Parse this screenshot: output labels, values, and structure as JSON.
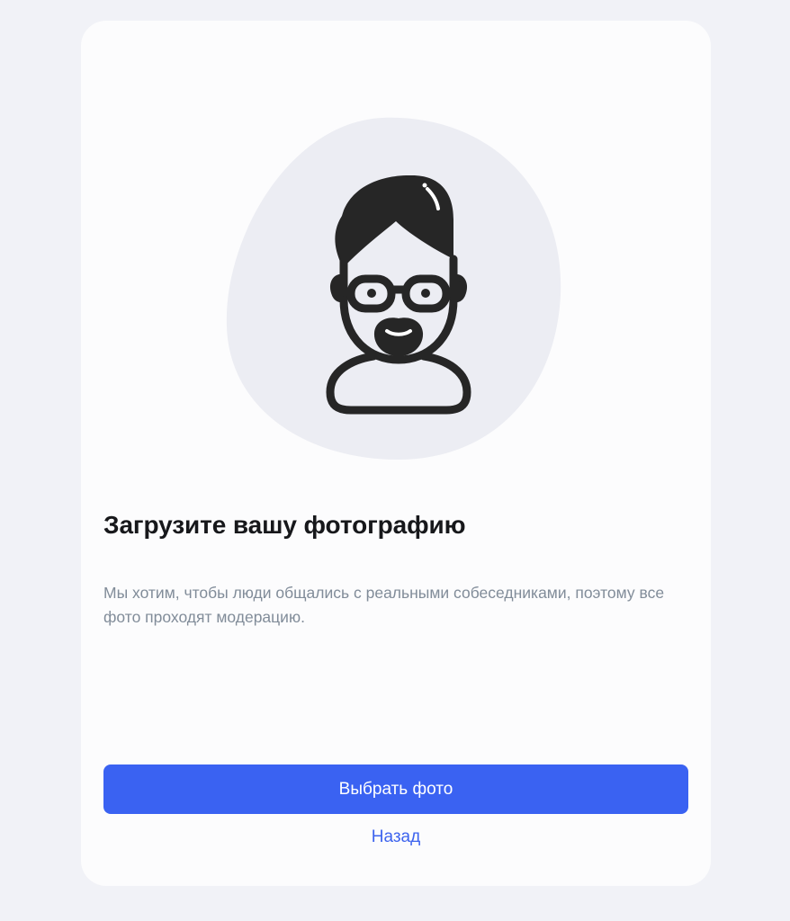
{
  "page": {
    "background_color": "#f1f2f7",
    "card_color": "#fcfcfd"
  },
  "illustration": {
    "icon": "man-with-glasses-avatar-icon",
    "blob_color": "#ecedf3",
    "line_color": "#262626"
  },
  "content": {
    "title": "Загрузите вашу фотографию",
    "description": "Мы хотим, чтобы люди общались с реальными собеседниками, поэтому все фото проходят модерацию."
  },
  "actions": {
    "primary_label": "Выбрать фото",
    "primary_color": "#3a62f2",
    "back_label": "Назад",
    "back_color": "#3d63ee"
  }
}
